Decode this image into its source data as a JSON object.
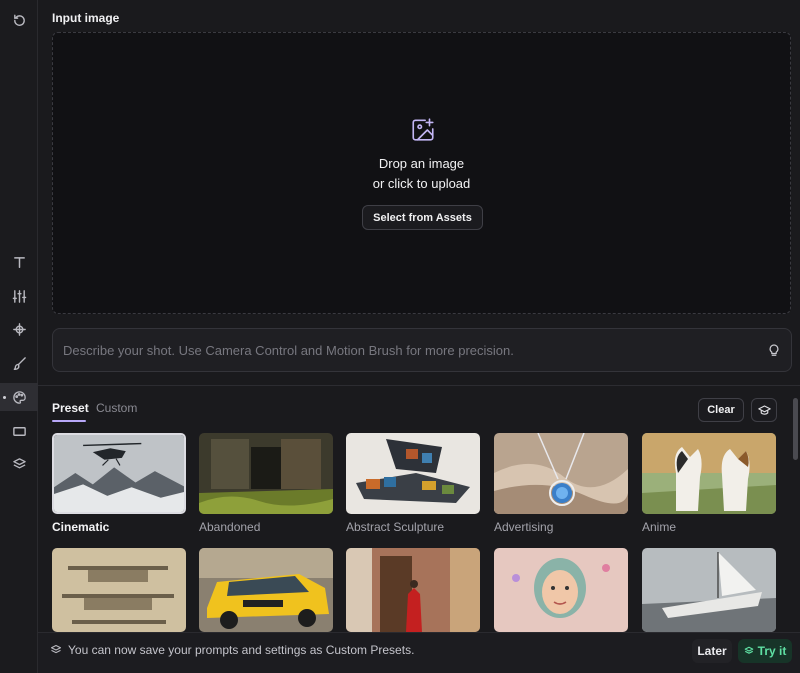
{
  "sidebar": {
    "items": [
      {
        "icon": "history-icon"
      },
      {
        "icon": "text-icon"
      },
      {
        "icon": "sliders-icon"
      },
      {
        "icon": "camera-move-icon"
      },
      {
        "icon": "brush-icon"
      },
      {
        "icon": "palette-icon",
        "active": true
      },
      {
        "icon": "aspect-ratio-icon"
      },
      {
        "icon": "layers-icon"
      }
    ]
  },
  "input_image": {
    "title": "Input image",
    "drop_line1": "Drop an image",
    "drop_line2": "or click to upload",
    "select_assets_label": "Select from Assets",
    "upload_icon": "image-plus-icon"
  },
  "prompt": {
    "placeholder": "Describe your shot. Use Camera Control and Motion Brush for more precision.",
    "value": "",
    "icon": "lightbulb-icon"
  },
  "presets": {
    "tabs": [
      {
        "label": "Preset",
        "active": true
      },
      {
        "label": "Custom",
        "active": false
      }
    ],
    "clear_label": "Clear",
    "cap_icon": "graduation-cap-icon",
    "tiles": [
      {
        "label": "Cinematic",
        "selected": true
      },
      {
        "label": "Abandoned",
        "selected": false
      },
      {
        "label": "Abstract Sculpture",
        "selected": false
      },
      {
        "label": "Advertising",
        "selected": false
      },
      {
        "label": "Anime",
        "selected": false
      }
    ]
  },
  "banner": {
    "icon": "layers-icon",
    "text": "You can now save your prompts and settings as Custom Presets.",
    "later_label": "Later",
    "try_label": "Try it",
    "accent": "#5fe0a3"
  },
  "colors": {
    "background": "#1a1a1d",
    "dropzone": "#111114",
    "accent_purple": "#b8a8f8"
  }
}
